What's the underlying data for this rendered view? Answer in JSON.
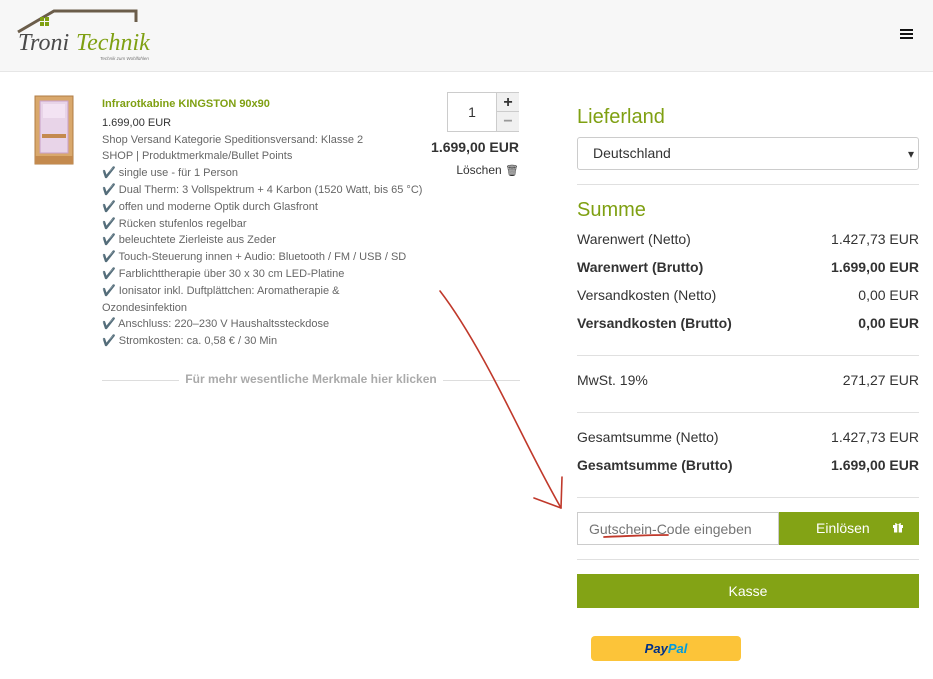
{
  "header": {
    "brand_part1": "Troni",
    "brand_part2": "Technik",
    "brand_tagline": "Technik zum Wohlfühlen"
  },
  "product": {
    "title": "Infrarotkabine KINGSTON 90x90",
    "price": "1.699,00 EUR",
    "lines": [
      "Shop Versand Kategorie Speditionsversand: Klasse 2",
      "SHOP | Produktmerkmale/Bullet Points",
      "✔️ single use - für 1 Person",
      "✔️ Dual Therm: 3 Vollspektrum + 4 Karbon (1520 Watt, bis 65 °C)",
      "✔️ offen und moderne Optik durch Glasfront",
      "✔️ Rücken stufenlos regelbar",
      "✔️ beleuchtete Zierleiste aus Zeder",
      "✔️ Touch-Steuerung innen + Audio: Bluetooth / FM / USB / SD",
      "✔️ Farblichttherapie über 30 x 30 cm LED-Platine",
      "✔️ Ionisator inkl. Duftplättchen: Aromatherapie &",
      "Ozondesinfektion",
      "✔️ Anschluss: 220–230 V Haushaltssteckdose",
      "✔️ Stromkosten: ca. 0,58 € / 30 Min"
    ],
    "quantity": "1",
    "plus": "+",
    "minus": "−",
    "line_total": "1.699,00 EUR",
    "delete_label": "Löschen",
    "delete_icon": "🗑",
    "more_link": "Für mehr wesentliche Merkmale hier klicken"
  },
  "shipping": {
    "heading": "Lieferland",
    "country": "Deutschland"
  },
  "summary": {
    "heading": "Summe",
    "rows": [
      {
        "label": "Warenwert (Netto)",
        "value": "1.427,73 EUR"
      },
      {
        "label": "Warenwert (Brutto)",
        "value": "1.699,00 EUR"
      },
      {
        "label": "Versandkosten (Netto)",
        "value": "0,00 EUR"
      },
      {
        "label": "Versandkosten (Brutto)",
        "value": "0,00 EUR"
      },
      {
        "label": "MwSt. 19%",
        "value": "271,27 EUR"
      },
      {
        "label": "Gesamtsumme (Netto)",
        "value": "1.427,73 EUR"
      },
      {
        "label": "Gesamtsumme (Brutto)",
        "value": "1.699,00 EUR"
      }
    ]
  },
  "coupon": {
    "placeholder": "Gutschein-Code eingeben",
    "button": "Einlösen"
  },
  "checkout": {
    "button": "Kasse",
    "paypal_part1": "Pay",
    "paypal_part2": "Pal"
  },
  "colors": {
    "accent_green": "#83a315",
    "annotation_red": "#c0392b",
    "paypal_yellow": "#fcc439"
  }
}
